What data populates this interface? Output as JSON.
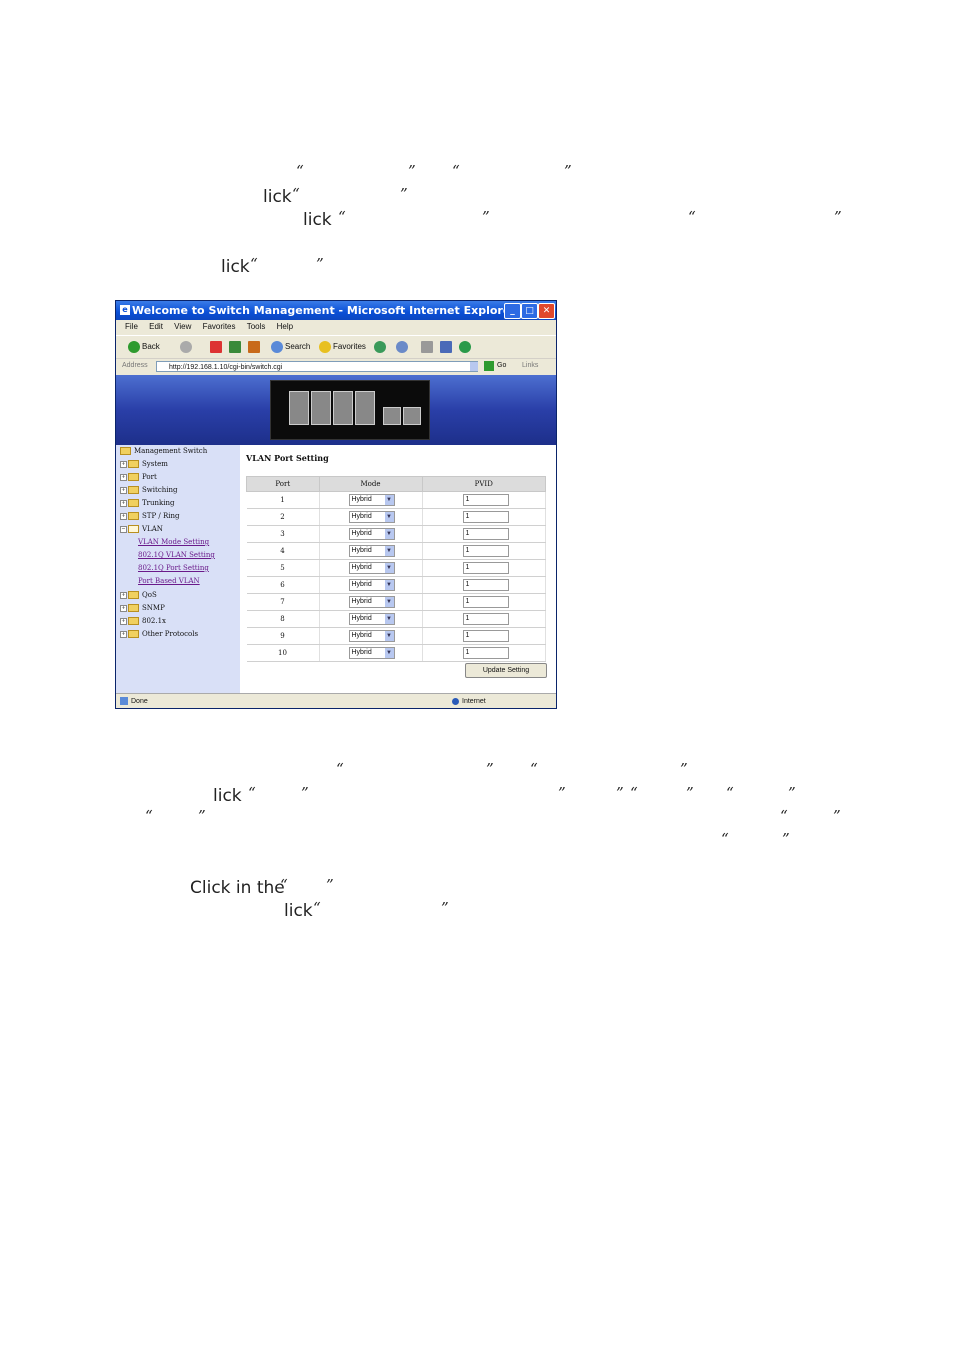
{
  "text": {
    "line2_prefix": "lick",
    "line3_prefix": "lick",
    "line4_prefix": "lick",
    "lower1_prefix": "lick",
    "lower3": "Click in the",
    "lower4_prefix": "lick",
    "open_quote": "“",
    "close_quote": "”"
  },
  "window": {
    "title": "Welcome to Switch Management - Microsoft Internet Explorer",
    "menu": [
      "File",
      "Edit",
      "View",
      "Favorites",
      "Tools",
      "Help"
    ],
    "toolbar": {
      "back": "Back",
      "search": "Search",
      "favorites": "Favorites"
    },
    "address_label": "Address",
    "address_value": "http://192.168.1.10/cgi-bin/switch.cgi",
    "go_label": "Go",
    "links_label": "Links",
    "status_left": "Done",
    "status_right": "Internet"
  },
  "sidebar": {
    "root": "Management Switch",
    "items": [
      "System",
      "Port",
      "Switching",
      "Trunking",
      "STP / Ring",
      "VLAN",
      "QoS",
      "SNMP",
      "802.1x",
      "Other Protocols"
    ],
    "vlan_children": [
      "VLAN Mode Setting",
      "802.1Q VLAN Setting",
      "802.1Q Port Setting",
      "Port Based VLAN"
    ]
  },
  "content": {
    "title": "VLAN Port Setting",
    "headers": [
      "Port",
      "Mode",
      "PVID"
    ],
    "rows": [
      {
        "port": "1",
        "mode": "Hybrid",
        "pvid": "1"
      },
      {
        "port": "2",
        "mode": "Hybrid",
        "pvid": "1"
      },
      {
        "port": "3",
        "mode": "Hybrid",
        "pvid": "1"
      },
      {
        "port": "4",
        "mode": "Hybrid",
        "pvid": "1"
      },
      {
        "port": "5",
        "mode": "Hybrid",
        "pvid": "1"
      },
      {
        "port": "6",
        "mode": "Hybrid",
        "pvid": "1"
      },
      {
        "port": "7",
        "mode": "Hybrid",
        "pvid": "1"
      },
      {
        "port": "8",
        "mode": "Hybrid",
        "pvid": "1"
      },
      {
        "port": "9",
        "mode": "Hybrid",
        "pvid": "1"
      },
      {
        "port": "10",
        "mode": "Hybrid",
        "pvid": "1"
      }
    ],
    "update_button": "Update Setting"
  }
}
